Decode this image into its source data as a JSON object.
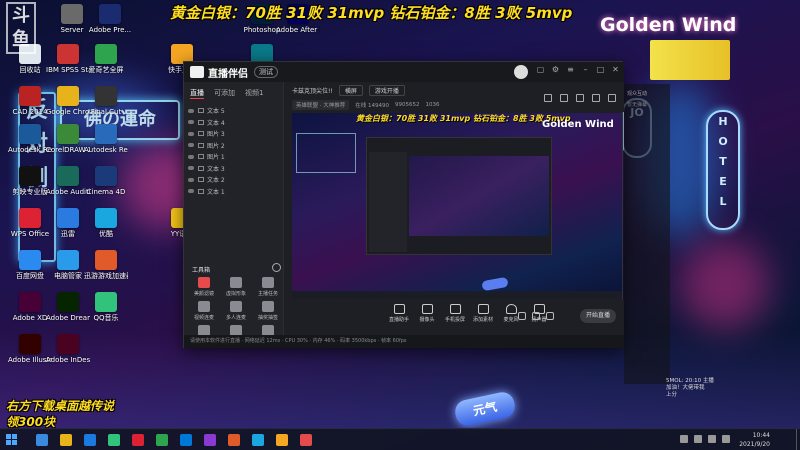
{
  "overlays": {
    "top_text": "黄金白银：70胜 31败 31mvp 钻石铂金：8胜 3败 5mvp",
    "bottom_left_line1": "右方下载桌面越传说",
    "bottom_left_line2": "领300块",
    "logo_text": "斗鱼"
  },
  "wallpaper": {
    "golden_wind": "Golden Wind",
    "neon_sign": "佛の運命",
    "neon_vertical": "反対側",
    "hotel": [
      "H",
      "O",
      "T",
      "E",
      "L"
    ],
    "jo": "JO",
    "can_text": "元气"
  },
  "desktop_icons": [
    {
      "label": "Server",
      "color": "#6a6a6a"
    },
    {
      "label": "Adobe Pre...",
      "color": "#1b2b6f"
    },
    {
      "label": "回收站",
      "color": "#dfe6ee"
    },
    {
      "label": "IBM SPSS Statistics 21",
      "color": "#c33"
    },
    {
      "label": "爱奇艺全屏",
      "color": "#2ea44f"
    },
    {
      "label": "快手直播",
      "color": "#f5a623"
    },
    {
      "label": "CAD 2014",
      "color": "#b22"
    },
    {
      "label": "Google Chrome",
      "color": "#e8b21a"
    },
    {
      "label": "Final Cut",
      "color": "#333"
    },
    {
      "label": "Autodesk ReCap",
      "color": "#1a5a9a"
    },
    {
      "label": "CorelDRAW 2020 (64...",
      "color": "#3a8a3a"
    },
    {
      "label": "Autodesk ReCap",
      "color": "#2a6aba"
    },
    {
      "label": "Cinema 4D",
      "color": "#1a3a7a"
    },
    {
      "label": "Adobe Audition",
      "color": "#1a6a5a"
    },
    {
      "label": "剪映专业版",
      "color": "#111"
    },
    {
      "label": "WPS Office",
      "color": "#d23"
    },
    {
      "label": "迅雷",
      "color": "#2a7ae0"
    },
    {
      "label": "优酷",
      "color": "#1aa7e0"
    },
    {
      "label": "百度网盘",
      "color": "#2a8af0"
    },
    {
      "label": "电脑管家",
      "color": "#2a9aea"
    },
    {
      "label": "迅游游戏加速器",
      "color": "#e05a2a"
    },
    {
      "label": "Adobe XD",
      "color": "#470137"
    },
    {
      "label": "Adobe Dreamweaver",
      "color": "#072401"
    },
    {
      "label": "QQ音乐",
      "color": "#31c27c"
    },
    {
      "label": "Adobe Illustrator",
      "color": "#330000"
    },
    {
      "label": "Adobe InDesign",
      "color": "#49021f"
    },
    {
      "label": "YY语音",
      "color": "#f5c518"
    },
    {
      "label": "Adobe After Effects CC",
      "color": "#00005b"
    },
    {
      "label": "Autodesk 3ds Max",
      "color": "#0a7a8a"
    },
    {
      "label": "Photoshop",
      "color": "#001e36"
    }
  ],
  "app": {
    "name": "直播伴侣",
    "version": "测试",
    "side_tabs": [
      "直播",
      "可添加",
      "视频1"
    ],
    "scenes": [
      "文本 5",
      "文本 4",
      "图片 3",
      "图片 2",
      "图片 1",
      "文本 3",
      "文本 2",
      "文本 1"
    ],
    "tools_header": "工具箱",
    "tools": [
      {
        "label": "美颜滤镜",
        "color": "#e64b4b"
      },
      {
        "label": "虚拟形象",
        "color": "#8a8a92"
      },
      {
        "label": "主播任务",
        "color": "#8a8a92"
      },
      {
        "label": "视频连麦",
        "color": "#8a8a92"
      },
      {
        "label": "多人连麦",
        "color": "#8a8a92"
      },
      {
        "label": "抽奖抽签",
        "color": "#8a8a92"
      },
      {
        "label": "虚拟开播",
        "color": "#8a8a92"
      },
      {
        "label": "弹幕助手",
        "color": "#8a8a92"
      },
      {
        "label": "数据统计",
        "color": "#8a8a92"
      }
    ],
    "room_title": "卡兹克顶尖位!!",
    "mode_pill": "横屏",
    "game_pill": "游戏开播",
    "status_pill": "英雄联盟 · 大神推荐",
    "viewer_label": "在线 149490",
    "likes_label": "9905652",
    "time_label": "1036",
    "toolbar_buttons": [
      "直播助手",
      "摄像头",
      "手机投屏",
      "添加素材",
      "麦克风",
      "扬声器"
    ],
    "go_live": "开始直播",
    "statusbar_text": "请使用本软件进行直播  ·  网络延迟 12ms  ·  CPU 30%  ·  内存 46%  ·  码率 3500kbps  ·  帧率 60fps"
  },
  "preview": {
    "overlay": "黄金白银：70胜 31败 31mvp 钻石铂金：8胜 3败 5mvp",
    "golden_wind": "Golden Wind"
  },
  "right_panel": {
    "line1": "观众互动",
    "line2": "暂无弹幕",
    "chat": [
      "5MOL: 20:10 主播",
      "加油！大佬带我",
      "上分"
    ]
  },
  "taskbar": {
    "icons": [
      "#3a8ae0",
      "#e8b21a",
      "#1a7ae0",
      "#31c27c",
      "#d23",
      "#2ea44f",
      "#0078d7",
      "#8a3ad0",
      "#e05a2a",
      "#1aa7e0",
      "#f5a623",
      "#e64b4b"
    ],
    "time": "10:44",
    "date": "2021/9/20"
  }
}
